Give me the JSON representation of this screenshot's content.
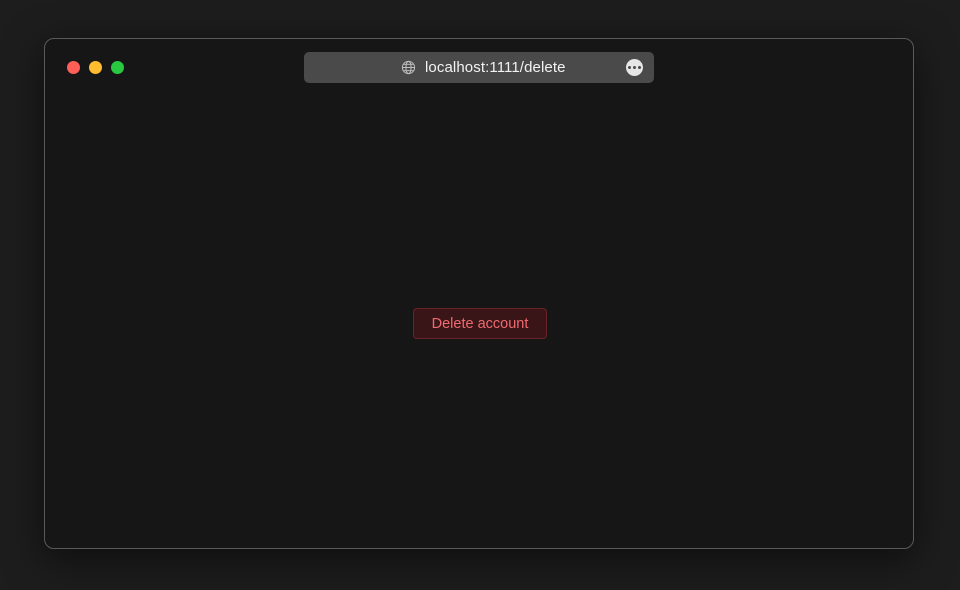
{
  "browser": {
    "url": "localhost:1111/delete",
    "address_icon": "globe-icon",
    "more_icon": "ellipsis-circle-icon",
    "traffic_lights": {
      "close_color": "#fe5f57",
      "minimize_color": "#febc2e",
      "maximize_color": "#28c840"
    }
  },
  "page": {
    "delete_button_label": "Delete account",
    "colors": {
      "background": "#161616",
      "danger_text": "#f06a6f",
      "danger_bg": "#3a1518"
    }
  }
}
